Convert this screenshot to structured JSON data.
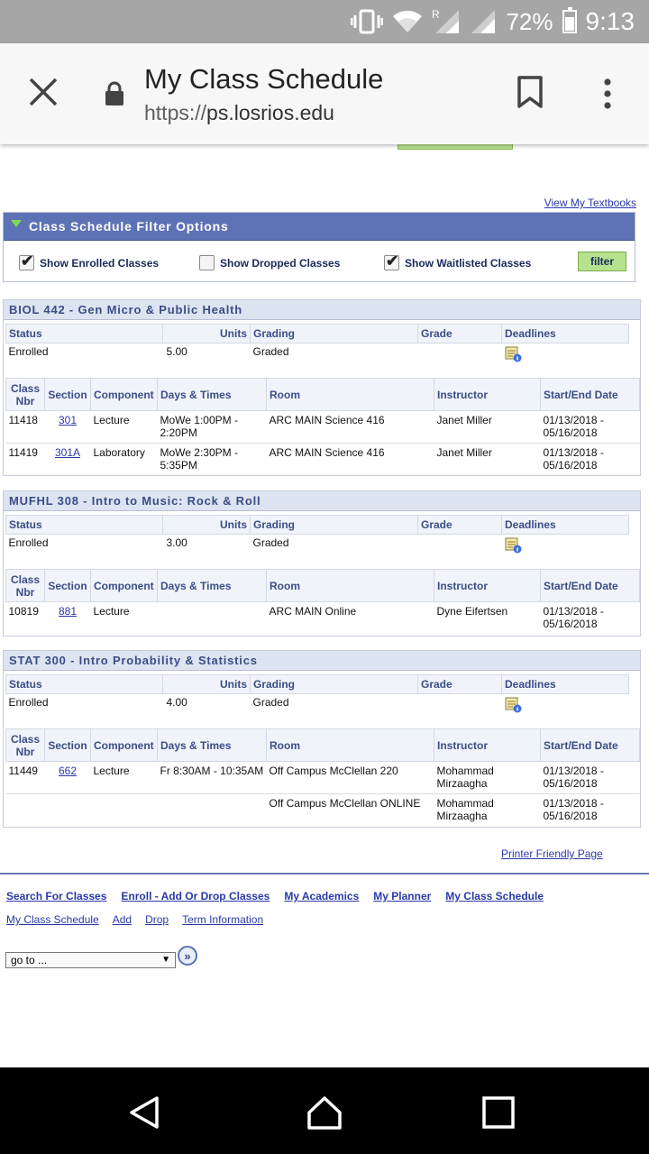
{
  "status_bar": {
    "battery": "72%",
    "time": "9:13",
    "icons": [
      "vibrate-icon",
      "wifi-icon",
      "signal-roaming-icon",
      "signal-icon",
      "battery-icon"
    ]
  },
  "browser": {
    "title": "My Class Schedule",
    "url_scheme": "https://",
    "url_host": "ps.losrios.edu",
    "icons": [
      "close-icon",
      "lock-icon",
      "bookmark-icon",
      "more-vert-icon"
    ]
  },
  "page": {
    "textbooks_link": "View My Textbooks",
    "filter": {
      "title": "Class Schedule Filter Options",
      "enrolled": {
        "label": "Show Enrolled Classes",
        "checked": true
      },
      "dropped": {
        "label": "Show Dropped Classes",
        "checked": false
      },
      "waitlisted": {
        "label": "Show Waitlisted Classes",
        "checked": true
      },
      "button": "filter"
    },
    "status_headers": {
      "status": "Status",
      "units": "Units",
      "grading": "Grading",
      "grade": "Grade",
      "deadlines": "Deadlines"
    },
    "class_headers": {
      "class_nbr": "Class Nbr",
      "section": "Section",
      "component": "Component",
      "days_times": "Days & Times",
      "room": "Room",
      "instructor": "Instructor",
      "start_end": "Start/End Date"
    },
    "courses": [
      {
        "title": "BIOL 442 - Gen Micro & Public Health",
        "status": "Enrolled",
        "units": "5.00",
        "grading": "Graded",
        "grade": "",
        "rows": [
          {
            "nbr": "11418",
            "section": "301",
            "component": "Lecture",
            "days": "MoWe 1:00PM - 2:20PM",
            "room": "ARC MAIN Science 416",
            "instructor": "Janet Miller",
            "dates": "01/13/2018 - 05/16/2018"
          },
          {
            "nbr": "11419",
            "section": "301A",
            "component": "Laboratory",
            "days": "MoWe 2:30PM - 5:35PM",
            "room": "ARC MAIN Science 416",
            "instructor": "Janet Miller",
            "dates": "01/13/2018 - 05/16/2018"
          }
        ]
      },
      {
        "title": "MUFHL 308 - Intro to Music: Rock & Roll",
        "status": "Enrolled",
        "units": "3.00",
        "grading": "Graded",
        "grade": "",
        "rows": [
          {
            "nbr": "10819",
            "section": "881",
            "component": "Lecture",
            "days": "",
            "room": "ARC MAIN Online",
            "instructor": "Dyne Eifertsen",
            "dates": "01/13/2018 - 05/16/2018"
          }
        ]
      },
      {
        "title": "STAT 300 - Intro Probability & Statistics",
        "status": "Enrolled",
        "units": "4.00",
        "grading": "Graded",
        "grade": "",
        "rows": [
          {
            "nbr": "11449",
            "section": "662",
            "component": "Lecture",
            "days": "Fr 8:30AM - 10:35AM",
            "room": "Off Campus McClellan 220",
            "instructor": "Mohammad Mirzaagha",
            "dates": "01/13/2018 - 05/16/2018"
          },
          {
            "nbr": "",
            "section": "",
            "component": "",
            "days": "",
            "room": "Off Campus McClellan ONLINE",
            "instructor": "Mohammad Mirzaagha",
            "dates": "01/13/2018 - 05/16/2018"
          }
        ]
      }
    ],
    "printer_link": "Printer Friendly Page",
    "nav_main": [
      "Search For Classes",
      "Enroll - Add Or Drop Classes",
      "My Academics",
      "My Planner",
      "My Class Schedule"
    ],
    "nav_sub": [
      "My Class Schedule",
      "Add",
      "Drop",
      "Term Information"
    ],
    "goto": "go to ...",
    "go_button": "»"
  },
  "android_nav": [
    "back-icon",
    "home-icon",
    "recents-icon"
  ]
}
